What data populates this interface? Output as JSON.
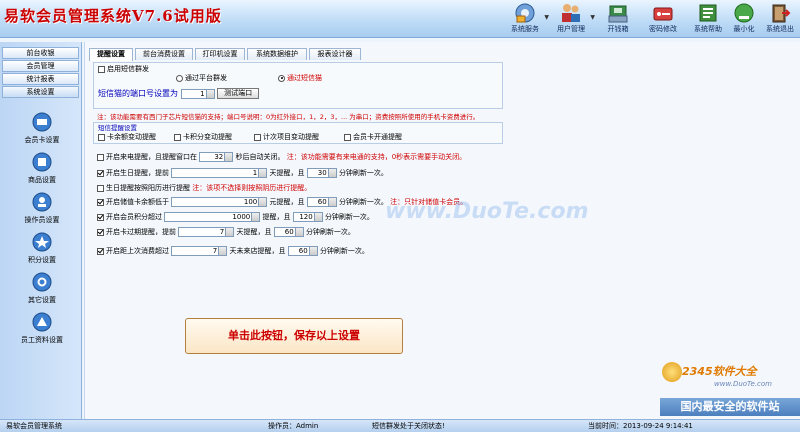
{
  "app": {
    "title": "易软会员管理系统V7.6试用版"
  },
  "toolbar": {
    "items": [
      {
        "label": "系统服务",
        "icon": "system-service-icon"
      },
      {
        "label": "用户管理",
        "icon": "user-management-icon"
      },
      {
        "label": "开钱箱",
        "icon": "cash-drawer-icon"
      },
      {
        "label": "密码修改",
        "icon": "password-change-icon"
      },
      {
        "label": "系统帮助",
        "icon": "help-icon"
      },
      {
        "label": "最小化",
        "icon": "minimize-icon"
      },
      {
        "label": "系统退出",
        "icon": "exit-icon"
      }
    ]
  },
  "sidebar": {
    "nav": [
      "前台收银",
      "会员管理",
      "统计报表",
      "系统设置"
    ],
    "buttons": [
      {
        "label": "会员卡设置",
        "icon": "member-card-icon"
      },
      {
        "label": "商品设置",
        "icon": "product-icon"
      },
      {
        "label": "操作员设置",
        "icon": "operator-icon"
      },
      {
        "label": "积分设置",
        "icon": "points-icon"
      },
      {
        "label": "其它设置",
        "icon": "other-settings-icon"
      },
      {
        "label": "员工资料设置",
        "icon": "staff-icon"
      }
    ]
  },
  "tabs": [
    "提醒设置",
    "前台消费设置",
    "打印机设置",
    "系统数据维护",
    "报表设计器"
  ],
  "sms": {
    "enable": "启用短信群发",
    "platform": "通过平台群发",
    "cat": "通过短信猫",
    "port_label": "短信猫的端口号设置为",
    "port_value": "1",
    "test_button": "测试端口",
    "note": "注：该功能需要有西门子芯片短信猫的支持；端口号说明：0为红外接口，1，2，3，... 为串口；资费按照所使用的手机卡资费进行。"
  },
  "sms_remind": {
    "title": "短信提醒设置",
    "options": [
      "卡余额变动提醒",
      "卡积分变动提醒",
      "计次项目变动提醒",
      "会员卡开通提醒"
    ]
  },
  "reminders": {
    "caller": {
      "text": "开启来电提醒，且提醒窗口在",
      "value": "32",
      "suffix": "秒后自动关闭。",
      "note": "注：该功能需要有来电通的支持，0秒表示需要手动关闭。"
    },
    "birthday": {
      "text": "开启生日提醒，提前",
      "value": "1",
      "mid": "天提醒，且",
      "value2": "30",
      "suffix": "分钟刷新一次。"
    },
    "lunar": {
      "text": "生日提醒按照阳历进行提醒",
      "note": "注：该项不选择则按照阴历进行提醒。"
    },
    "balance": {
      "text": "开启储值卡余额低于",
      "value": "100",
      "mid": "元提醒，且",
      "value2": "60",
      "suffix": "分钟刷新一次。",
      "note": "注：只针对储值卡会员。"
    },
    "points": {
      "text": "开启会员积分超过",
      "value": "1000",
      "mid": "提醒，且",
      "value2": "120",
      "suffix": "分钟刷新一次。"
    },
    "expire": {
      "text": "开启卡过期提醒，提前",
      "value": "7",
      "mid": "天提醒，且",
      "value2": "60",
      "suffix": "分钟刷新一次。"
    },
    "last_visit": {
      "text": "开启距上次消费超过",
      "value": "7",
      "mid": "天未来店提醒，且",
      "value2": "60",
      "suffix": "分钟刷新一次。"
    }
  },
  "save_button": "单击此按钮，保存以上设置",
  "watermarks": {
    "center": "www.DuoTe.com",
    "brand": "2345软件大全",
    "url": "www.DuoTe.com",
    "slogan": "国内最安全的软件站"
  },
  "status": {
    "app_name": "易软会员管理系统",
    "operator": "操作员：Admin",
    "sms_state": "短信群发处于关闭状态!",
    "time": "当前时间：2013-09-24 9:14:41"
  },
  "colors": {
    "title_red": "#cc0000",
    "note_red": "#d00000",
    "accent_blue": "#0000b8"
  }
}
